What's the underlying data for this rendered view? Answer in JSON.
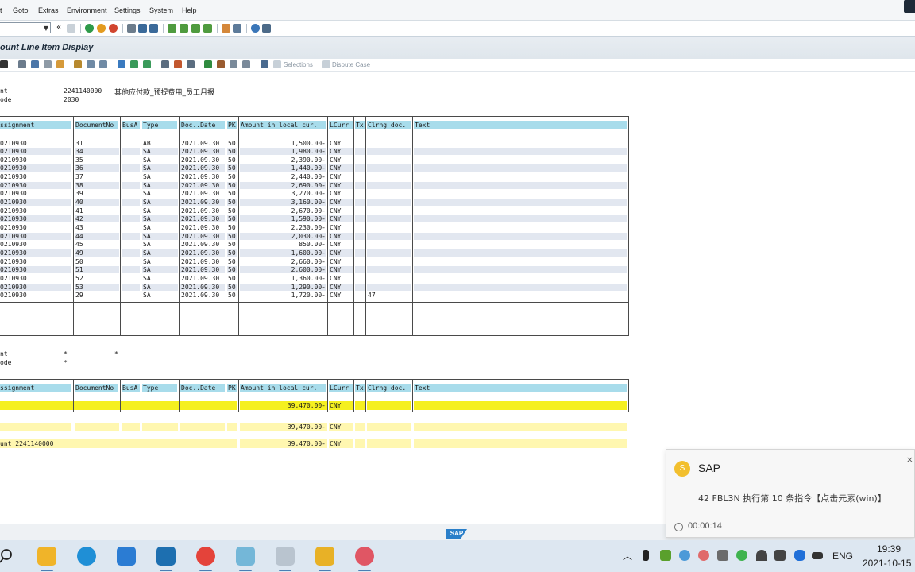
{
  "menu": {
    "items": [
      "Goto",
      "Extras",
      "Environment",
      "Settings",
      "System",
      "Help"
    ]
  },
  "toolbar": {
    "command_value": "",
    "nav_glyph": "«"
  },
  "title": "ount Line Item Display",
  "app_toolbar": {
    "selections": "Selections",
    "dispute_case": "Dispute Case"
  },
  "header1": {
    "label1": "nt",
    "account": "2241140000",
    "account_desc": "其他应付款_预提费用_员工月报",
    "label2": "ode",
    "company_code": "2030"
  },
  "columns": [
    "ssignment",
    "DocumentNo",
    "BusA",
    "Type",
    "Doc..Date",
    "PK",
    "Amount in local cur.",
    "LCurr",
    "Tx",
    "Clrng doc.",
    "Text"
  ],
  "rows": [
    {
      "assignment": "0210930",
      "doc": "31",
      "type": "AB",
      "date": "2021.09.30",
      "pk": "50",
      "amount": "1,500.00-",
      "curr": "CNY",
      "clrng": ""
    },
    {
      "assignment": "0210930",
      "doc": "34",
      "type": "SA",
      "date": "2021.09.30",
      "pk": "50",
      "amount": "1,980.00-",
      "curr": "CNY",
      "clrng": ""
    },
    {
      "assignment": "0210930",
      "doc": "35",
      "type": "SA",
      "date": "2021.09.30",
      "pk": "50",
      "amount": "2,390.00-",
      "curr": "CNY",
      "clrng": ""
    },
    {
      "assignment": "0210930",
      "doc": "36",
      "type": "SA",
      "date": "2021.09.30",
      "pk": "50",
      "amount": "1,440.00-",
      "curr": "CNY",
      "clrng": ""
    },
    {
      "assignment": "0210930",
      "doc": "37",
      "type": "SA",
      "date": "2021.09.30",
      "pk": "50",
      "amount": "2,440.00-",
      "curr": "CNY",
      "clrng": ""
    },
    {
      "assignment": "0210930",
      "doc": "38",
      "type": "SA",
      "date": "2021.09.30",
      "pk": "50",
      "amount": "2,690.00-",
      "curr": "CNY",
      "clrng": ""
    },
    {
      "assignment": "0210930",
      "doc": "39",
      "type": "SA",
      "date": "2021.09.30",
      "pk": "50",
      "amount": "3,270.00-",
      "curr": "CNY",
      "clrng": ""
    },
    {
      "assignment": "0210930",
      "doc": "40",
      "type": "SA",
      "date": "2021.09.30",
      "pk": "50",
      "amount": "3,160.00-",
      "curr": "CNY",
      "clrng": ""
    },
    {
      "assignment": "0210930",
      "doc": "41",
      "type": "SA",
      "date": "2021.09.30",
      "pk": "50",
      "amount": "2,670.00-",
      "curr": "CNY",
      "clrng": ""
    },
    {
      "assignment": "0210930",
      "doc": "42",
      "type": "SA",
      "date": "2021.09.30",
      "pk": "50",
      "amount": "1,590.00-",
      "curr": "CNY",
      "clrng": ""
    },
    {
      "assignment": "0210930",
      "doc": "43",
      "type": "SA",
      "date": "2021.09.30",
      "pk": "50",
      "amount": "2,230.00-",
      "curr": "CNY",
      "clrng": ""
    },
    {
      "assignment": "0210930",
      "doc": "44",
      "type": "SA",
      "date": "2021.09.30",
      "pk": "50",
      "amount": "2,030.00-",
      "curr": "CNY",
      "clrng": ""
    },
    {
      "assignment": "0210930",
      "doc": "45",
      "type": "SA",
      "date": "2021.09.30",
      "pk": "50",
      "amount": "850.00-",
      "curr": "CNY",
      "clrng": ""
    },
    {
      "assignment": "0210930",
      "doc": "49",
      "type": "SA",
      "date": "2021.09.30",
      "pk": "50",
      "amount": "1,600.00-",
      "curr": "CNY",
      "clrng": ""
    },
    {
      "assignment": "0210930",
      "doc": "50",
      "type": "SA",
      "date": "2021.09.30",
      "pk": "50",
      "amount": "2,660.00-",
      "curr": "CNY",
      "clrng": ""
    },
    {
      "assignment": "0210930",
      "doc": "51",
      "type": "SA",
      "date": "2021.09.30",
      "pk": "50",
      "amount": "2,600.00-",
      "curr": "CNY",
      "clrng": ""
    },
    {
      "assignment": "0210930",
      "doc": "52",
      "type": "SA",
      "date": "2021.09.30",
      "pk": "50",
      "amount": "1,360.00-",
      "curr": "CNY",
      "clrng": ""
    },
    {
      "assignment": "0210930",
      "doc": "53",
      "type": "SA",
      "date": "2021.09.30",
      "pk": "50",
      "amount": "1,290.00-",
      "curr": "CNY",
      "clrng": ""
    },
    {
      "assignment": "0210930",
      "doc": "29",
      "type": "SA",
      "date": "2021.09.30",
      "pk": "50",
      "amount": "1,720.00-",
      "curr": "CNY",
      "clrng": "47"
    }
  ],
  "subtotal": {
    "amount": "39,470.00-",
    "curr": "CNY"
  },
  "account_total": {
    "label": "unt 2241140000",
    "amount": "39,470.00-",
    "curr": "CNY"
  },
  "header2": {
    "label1": "nt",
    "star1": "*",
    "star2": "*",
    "label2": "ode",
    "star3": "*"
  },
  "grand_total": {
    "amount": "39,470.00-",
    "curr": "CNY"
  },
  "sap_logo": "SAP",
  "notification": {
    "icon_letter": "S",
    "app": "SAP",
    "message": "42 FBL3N 执行第 10 条指令【点击元素(win)】",
    "elapsed": "00:00:14",
    "close": "×"
  },
  "taskbar": {
    "lang": "ENG",
    "time": "19:39",
    "date": "2021-10-15",
    "tray_up": "︿"
  },
  "colors": {
    "header_bar": "#a8dceb",
    "subtotal": "#fff7b0",
    "grand_total": "#f5f020",
    "row_shade": "#e2e7f0"
  }
}
